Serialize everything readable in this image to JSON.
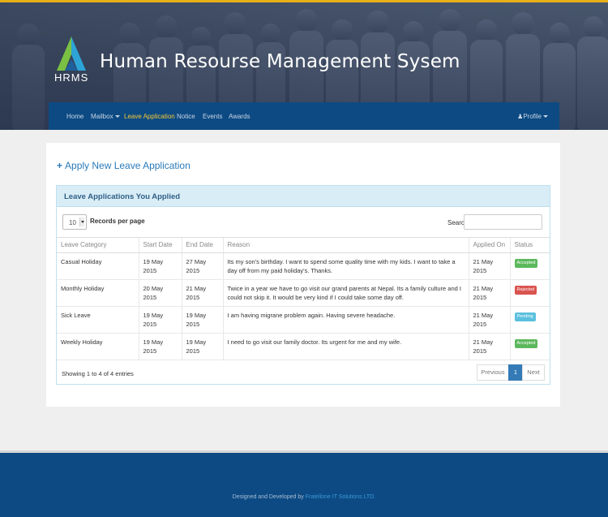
{
  "header": {
    "logo_text": "HRMS",
    "title": "Human Resourse Management Sysem"
  },
  "nav": {
    "items": [
      {
        "label": "Home"
      },
      {
        "label": "Mailbox"
      },
      {
        "label": "Leave Application",
        "active": true
      },
      {
        "label": "Notice"
      },
      {
        "label": "Events"
      },
      {
        "label": "Awards"
      }
    ],
    "profile_label": "Profile"
  },
  "main": {
    "apply_link": "Apply New Leave Application",
    "panel_title": "Leave Applications You Applied",
    "page_length": "10",
    "page_length_label": "Records per page",
    "search_label": "Search:",
    "search_value": "",
    "columns": [
      "Leave Category",
      "Start Date",
      "End Date",
      "Reason",
      "Applied On",
      "Status"
    ],
    "rows": [
      {
        "category": "Casual Holiday",
        "start": "19 May 2015",
        "end": "27 May 2015",
        "reason": "Its my son's birthday. I want to spend some quality time with my kids. I want to take a day off from my paid holiday's. Thanks.",
        "applied": "21 May 2015",
        "status": "Accepted",
        "status_color": "#5cb85c"
      },
      {
        "category": "Monthly Holiday",
        "start": "20 May 2015",
        "end": "21 May 2015",
        "reason": "Twice in a year we have to go visit our grand parents at Nepal. Its a family culture and I could not skip it. It would be very kind if I could take some day off.",
        "applied": "21 May 2015",
        "status": "Rejected",
        "status_color": "#d9534f"
      },
      {
        "category": "Sick Leave",
        "start": "19 May 2015",
        "end": "19 May 2015",
        "reason": "I am having migrane problem again. Having severe headache.",
        "applied": "21 May 2015",
        "status": "Pending",
        "status_color": "#5bc0de"
      },
      {
        "category": "Weekly Holiday",
        "start": "19 May 2015",
        "end": "19 May 2015",
        "reason": "I need to go visit our family doctor. Its urgent for me and my wife.",
        "applied": "21 May 2015",
        "status": "Accepted",
        "status_color": "#5cb85c"
      }
    ],
    "info": "Showing 1 to 4 of 4 entries",
    "pagination": {
      "previous": "Previous",
      "current": "1",
      "next": "Next"
    }
  },
  "footer": {
    "prefix": "Designed and Developed by",
    "company": "Fratellone IT Solutions LTD."
  },
  "colors": {
    "accent_top": "#e8b018",
    "nav_bg": "#0d4a83",
    "link": "#2a7ab8",
    "panel_heading": "#d9edf7"
  }
}
